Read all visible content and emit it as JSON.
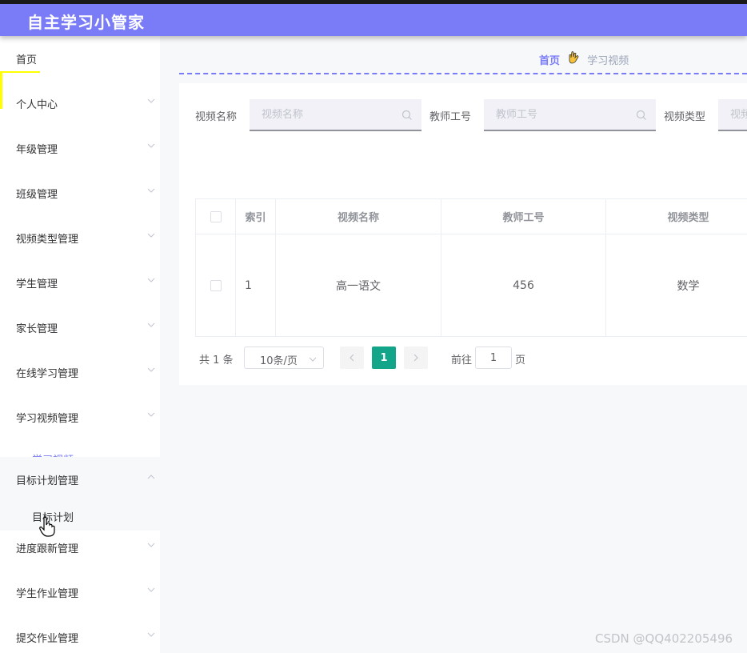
{
  "header": {
    "title": "自主学习小管家",
    "accent": "#7a7cf7"
  },
  "sidebar": {
    "items": [
      {
        "label": "首页",
        "top": 0,
        "chevron": "none"
      },
      {
        "label": "个人中心",
        "chevron": "down"
      },
      {
        "label": "年级管理",
        "chevron": "down"
      },
      {
        "label": "班级管理",
        "chevron": "down"
      },
      {
        "label": "视频类型管理",
        "chevron": "down"
      },
      {
        "label": "学生管理",
        "chevron": "down"
      },
      {
        "label": "家长管理",
        "chevron": "down"
      },
      {
        "label": "在线学习管理",
        "chevron": "down"
      },
      {
        "label": "学习视频管理",
        "chevron": "down"
      },
      {
        "label": "目标计划管理",
        "chevron": "up"
      },
      {
        "label": "进度跟新管理",
        "chevron": "down"
      },
      {
        "label": "学生作业管理",
        "chevron": "down"
      },
      {
        "label": "提交作业管理",
        "chevron": "down"
      }
    ],
    "partial_sub_label": "学习视频",
    "sub_item_label": "目标计划"
  },
  "breadcrumb": {
    "home": "首页",
    "separator_icon": "hand-icon",
    "current": "学习视频"
  },
  "filters": [
    {
      "label": "视频名称",
      "placeholder": "视频名称"
    },
    {
      "label": "教师工号",
      "placeholder": "教师工号"
    },
    {
      "label": "视频类型",
      "placeholder": "视频类型"
    }
  ],
  "table": {
    "headers": {
      "index": "索引",
      "name": "视频名称",
      "teacher_id": "教师工号",
      "type": "视频类型"
    },
    "rows": [
      {
        "index": "1",
        "name": "高一语文",
        "teacher_id": "456",
        "type": "数学"
      }
    ]
  },
  "pagination": {
    "total_text": "共 1 条",
    "page_size": "10条/页",
    "current_page": "1",
    "goto_label": "前往",
    "goto_value": "1",
    "page_suffix": "页",
    "active_color": "#13a58a"
  },
  "watermark": "CSDN @QQ402205496"
}
